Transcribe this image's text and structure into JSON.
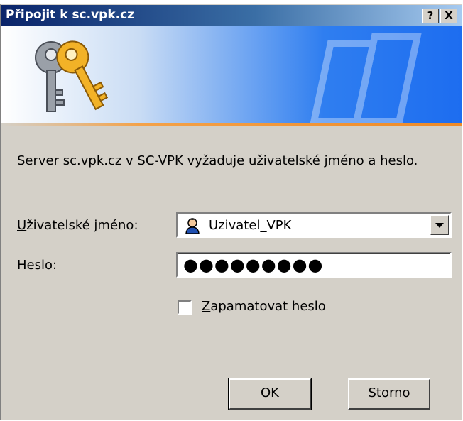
{
  "window": {
    "title": "Připojit k sc.vpk.cz",
    "help_label": "?",
    "close_label": "X"
  },
  "message": "Server sc.vpk.cz v SC-VPK vyžaduje uživatelské jméno a heslo.",
  "username": {
    "label_accel": "U",
    "label_rest": "živatelské jméno:",
    "value": "Uzivatel_VPK"
  },
  "password": {
    "label_accel": "H",
    "label_rest": "eslo:",
    "masked_value": "●●●●●●●●●"
  },
  "remember": {
    "label_accel": "Z",
    "label_rest": "apamatovat heslo",
    "checked": false
  },
  "buttons": {
    "ok": "OK",
    "cancel": "Storno"
  },
  "colors": {
    "face": "#d4d0c8",
    "title_start": "#0a246a",
    "title_end": "#a6caf0",
    "banner_blue": "#1d6df0",
    "accent_orange": "#ee8a27"
  },
  "icons": {
    "banner": "keys-icon",
    "user": "user-icon",
    "combo": "chevron-down-icon"
  }
}
